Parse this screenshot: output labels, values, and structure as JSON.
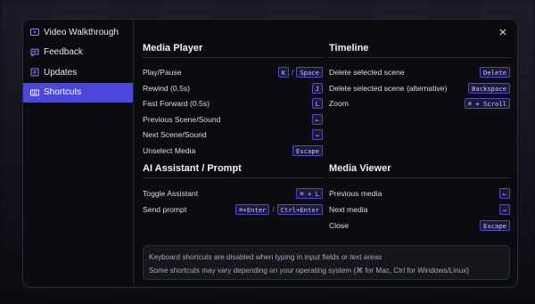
{
  "sidebar": {
    "items": [
      {
        "label": "Video Walkthrough",
        "icon": "video-icon",
        "active": false
      },
      {
        "label": "Feedback",
        "icon": "feedback-icon",
        "active": false
      },
      {
        "label": "Updates",
        "icon": "updates-icon",
        "active": false
      },
      {
        "label": "Shortcuts",
        "icon": "keyboard-icon",
        "active": true
      }
    ]
  },
  "close_icon": "close-icon",
  "sections": {
    "media_player": {
      "title": "Media Player",
      "rows": [
        {
          "label": "Play/Pause",
          "keys": [
            "K",
            "Space"
          ]
        },
        {
          "label": "Rewind (0.5s)",
          "keys": [
            "J"
          ]
        },
        {
          "label": "Fast Forward (0.5s)",
          "keys": [
            "L"
          ]
        },
        {
          "label": "Previous Scene/Sound",
          "keys": [
            "←"
          ]
        },
        {
          "label": "Next Scene/Sound",
          "keys": [
            "→"
          ]
        },
        {
          "label": "Unselect Media",
          "keys": [
            "Escape"
          ]
        }
      ]
    },
    "timeline": {
      "title": "Timeline",
      "rows": [
        {
          "label": "Delete selected scene",
          "keys": [
            "Delete"
          ]
        },
        {
          "label": "Delete selected scene (alternative)",
          "keys": [
            "Backspace"
          ]
        },
        {
          "label": "Zoom",
          "keys": [
            "⌘ + Scroll"
          ]
        }
      ]
    },
    "ai_assistant": {
      "title": "AI Assistant / Prompt",
      "rows": [
        {
          "label": "Toggle Assistant",
          "keys": [
            "⌘ + L"
          ]
        },
        {
          "label": "Send prompt",
          "keys": [
            "⌘+Enter",
            "Ctrl+Enter"
          ]
        }
      ]
    },
    "media_viewer": {
      "title": "Media Viewer",
      "rows": [
        {
          "label": "Previous media",
          "keys": [
            "←"
          ]
        },
        {
          "label": "Next media",
          "keys": [
            "→"
          ]
        },
        {
          "label": "Close",
          "keys": [
            "Escape"
          ]
        }
      ]
    }
  },
  "key_separator": "/",
  "notes": [
    "Keyboard shortcuts are disabled when typing in input fields or text areas",
    "Some shortcuts may vary depending on your operating system (⌘ for Mac, Ctrl for Windows/Linux)"
  ],
  "colors": {
    "accent": "#4b46dc",
    "kbd_border": "#4d46c9",
    "kbd_bg": "#1b1a3c",
    "kbd_text": "#c9c6ff",
    "modal_bg": "#0b0b10"
  }
}
